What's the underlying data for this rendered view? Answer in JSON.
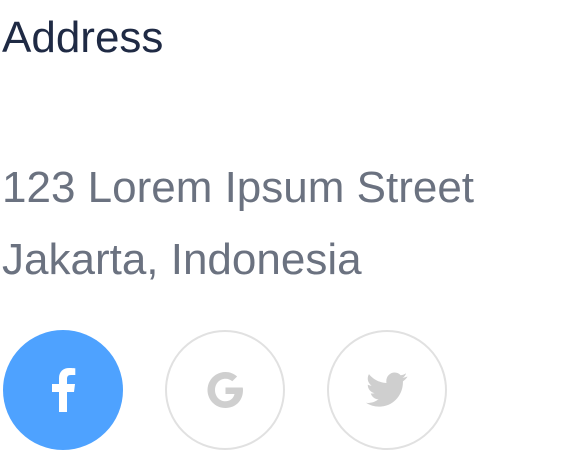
{
  "section": {
    "title": "Address"
  },
  "address": {
    "line1": "123 Lorem Ipsum Street",
    "line2": "Jakarta, Indonesia"
  },
  "social": {
    "buttons": [
      {
        "icon": "facebook-icon",
        "state": "active",
        "color": "#4ea2ff"
      },
      {
        "icon": "google-icon",
        "state": "default",
        "color": "#cfcfcf"
      },
      {
        "icon": "twitter-icon",
        "state": "default",
        "color": "#cfcfcf"
      }
    ]
  },
  "colors": {
    "heading": "#1f2a44",
    "body_text": "#6b7280",
    "accent": "#4ea2ff",
    "outline": "#e1e1e1"
  }
}
